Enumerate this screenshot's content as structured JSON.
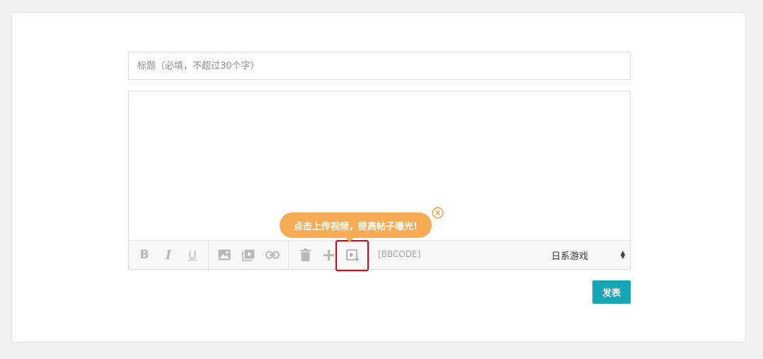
{
  "form": {
    "title_placeholder": "标题（必填，不超过30个字）",
    "title_value": "",
    "content_value": ""
  },
  "toolbar": {
    "bold_label": "B",
    "italic_label": "I",
    "underline_label": "U",
    "bbcode_label": "[BBCODE]",
    "icons": [
      "bold-icon",
      "italic-icon",
      "underline-icon",
      "image-icon",
      "video-library-icon",
      "link-icon",
      "trash-icon",
      "plus-icon",
      "video-upload-icon"
    ]
  },
  "category": {
    "selected": "日系游戏"
  },
  "tooltip": {
    "text": "点击上传视频，提高帖子曝光!"
  },
  "submit": {
    "label": "发表"
  },
  "colors": {
    "accent": "#17a6b4",
    "tooltip": "#f7ab55",
    "highlight": "#e60012"
  }
}
